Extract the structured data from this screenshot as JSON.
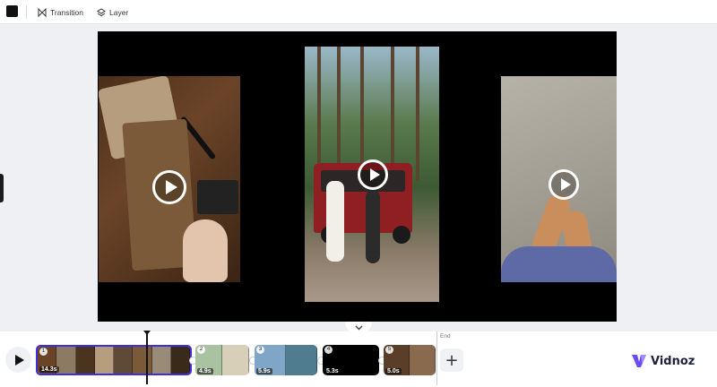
{
  "toolbar": {
    "color_swatch": "#111111",
    "transition_label": "Transition",
    "layer_label": "Layer"
  },
  "canvas": {
    "background": "#000000",
    "clips": [
      {
        "name": "gift-wrapping-clip",
        "icon": "play-icon"
      },
      {
        "name": "red-van-couple-clip",
        "icon": "play-icon"
      },
      {
        "name": "bare-feet-clip",
        "icon": "play-icon"
      }
    ]
  },
  "timeline": {
    "play_icon": "play-icon",
    "clips": [
      {
        "number": "1",
        "duration": "14.3s",
        "selected": true
      },
      {
        "number": "2",
        "duration": "4.9s",
        "selected": false
      },
      {
        "number": "3",
        "duration": "5.9s",
        "selected": false
      },
      {
        "number": "4",
        "duration": "5.3s",
        "selected": false
      },
      {
        "number": "5",
        "duration": "5.0s",
        "selected": false
      }
    ],
    "end_label": "End",
    "add_label": "+",
    "selection_color": "#3d2fdd"
  },
  "brand": {
    "name": "Vidnoz",
    "accent": "#6c4cf0"
  }
}
